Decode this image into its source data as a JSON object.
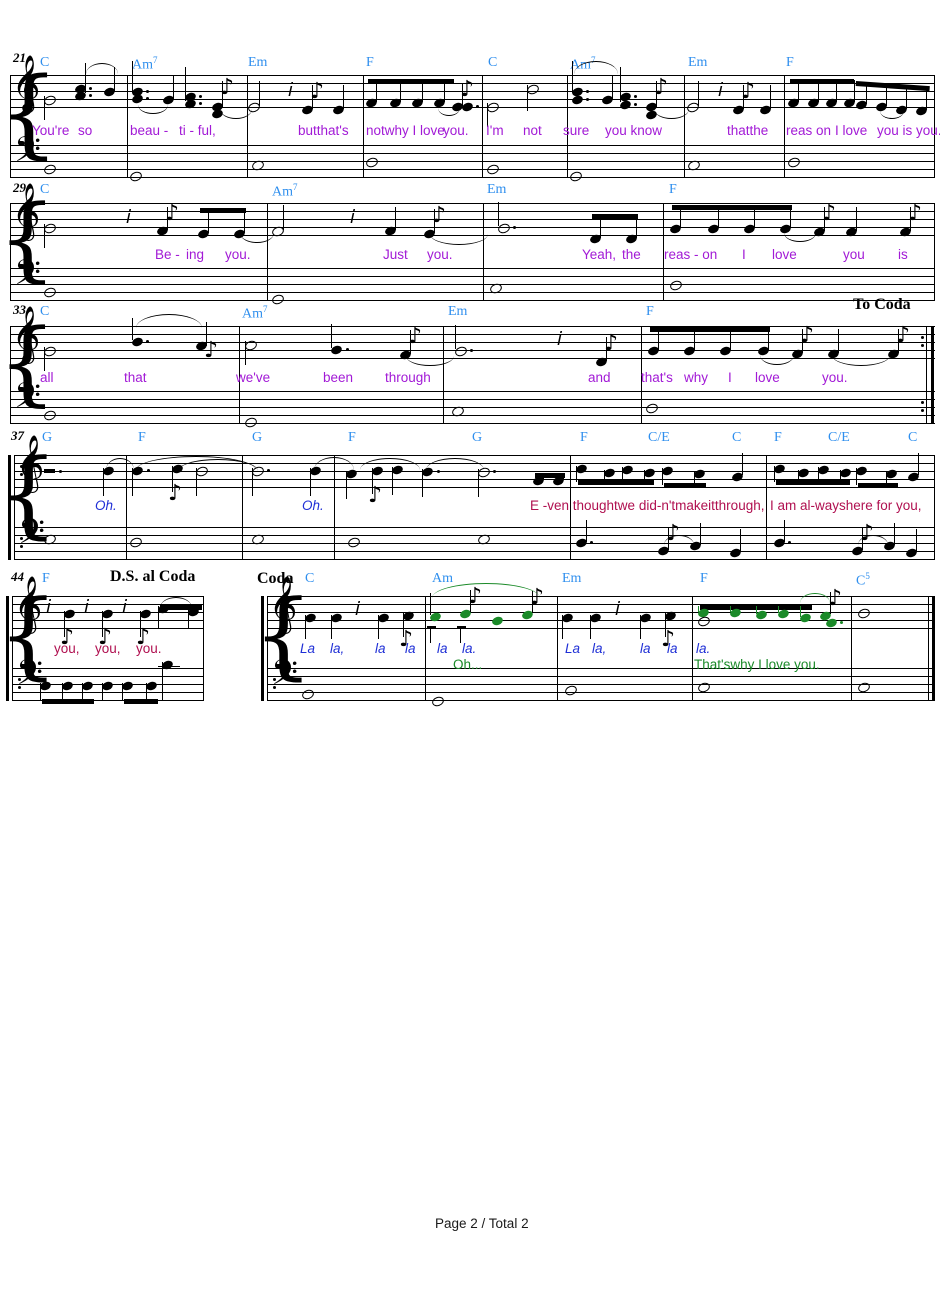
{
  "document": {
    "type": "sheet-music",
    "instrumentation": "piano-vocal (grand staff with chord symbols and lyrics)",
    "footer": "Page 2 / Total 2",
    "key_signature": "C major / no accidentals",
    "clefs": {
      "upper": "treble",
      "lower": "bass"
    }
  },
  "colors": {
    "chord_symbol": "#2f8fee",
    "lyric_verse_1": "#a21ad6",
    "lyric_verse_2": "#1f2fd6",
    "lyric_verse_3": "#b01050",
    "lyric_verse_4": "#1a8a28",
    "note_highlight": "#1a8a28",
    "staff": "#000000",
    "page_background": "#ffffff"
  },
  "systems": [
    {
      "measure_number": "21",
      "chords": [
        "C",
        "Am7",
        "Em",
        "F",
        "C",
        "Am7",
        "Em",
        "F"
      ],
      "lyrics": [
        "You're",
        "so",
        "beau -",
        "ti - ful,",
        "butthat's",
        "notwhy I love",
        "you.",
        "I'm",
        "not",
        "sure",
        "you know",
        "thatthe",
        "reas on",
        "I love",
        "you is you."
      ],
      "lyric_voice": "verse_1"
    },
    {
      "measure_number": "29",
      "chords": [
        "C",
        "Am7",
        "Em",
        "F"
      ],
      "lyrics": [
        "Be -",
        "ing",
        "you.",
        "Just",
        "you.",
        "Yeah,",
        "the",
        "reas - on",
        "I",
        "love",
        "you",
        "is"
      ],
      "lyric_voice": "verse_1"
    },
    {
      "measure_number": "33",
      "chords": [
        "C",
        "Am7",
        "Em",
        "F"
      ],
      "lyrics": [
        "all",
        "that",
        "we've",
        "been",
        "through",
        "and",
        "that's",
        "why",
        "I",
        "love",
        "you."
      ],
      "lyric_voice": "verse_1",
      "marking_right": "To Coda",
      "end_barline": "repeat-end"
    },
    {
      "measure_number": "37",
      "chords": [
        "G",
        "F",
        "G",
        "F",
        "G",
        "F",
        "C/E",
        "C",
        "F",
        "C/E",
        "C"
      ],
      "lyrics_verse_2": [
        "Oh.",
        "Oh."
      ],
      "lyrics_verse_3": [
        "E -ven thoughtwe did-n'tmakeitthrough,",
        "I  am  al-wayshere for you,"
      ],
      "start_barline": "repeat-start"
    },
    {
      "measure_number": "44",
      "chords": [
        "F"
      ],
      "lyrics_verse_3": [
        "you,",
        "you,",
        "you."
      ],
      "marking": "D.S. al Coda",
      "coda_section": {
        "label": "Coda",
        "chords": [
          "C",
          "Am",
          "Em",
          "F",
          "C5"
        ],
        "lyrics_verse_2": [
          "La",
          "la,",
          "la",
          "la",
          "la",
          "la.",
          "La",
          "la,",
          "la",
          "la",
          "la."
        ],
        "lyrics_verse_4": [
          "Oh...",
          "That'swhy I love   you."
        ],
        "end_barline": "final"
      }
    }
  ],
  "markings": {
    "to_coda": "To Coda",
    "ds_al_coda": "D.S. al Coda",
    "coda": "Coda"
  },
  "glyphs": {
    "treble_clef": "𝄞",
    "bass_clef": "𝄢",
    "eighth_rest": "𝄾",
    "brace": "{"
  }
}
